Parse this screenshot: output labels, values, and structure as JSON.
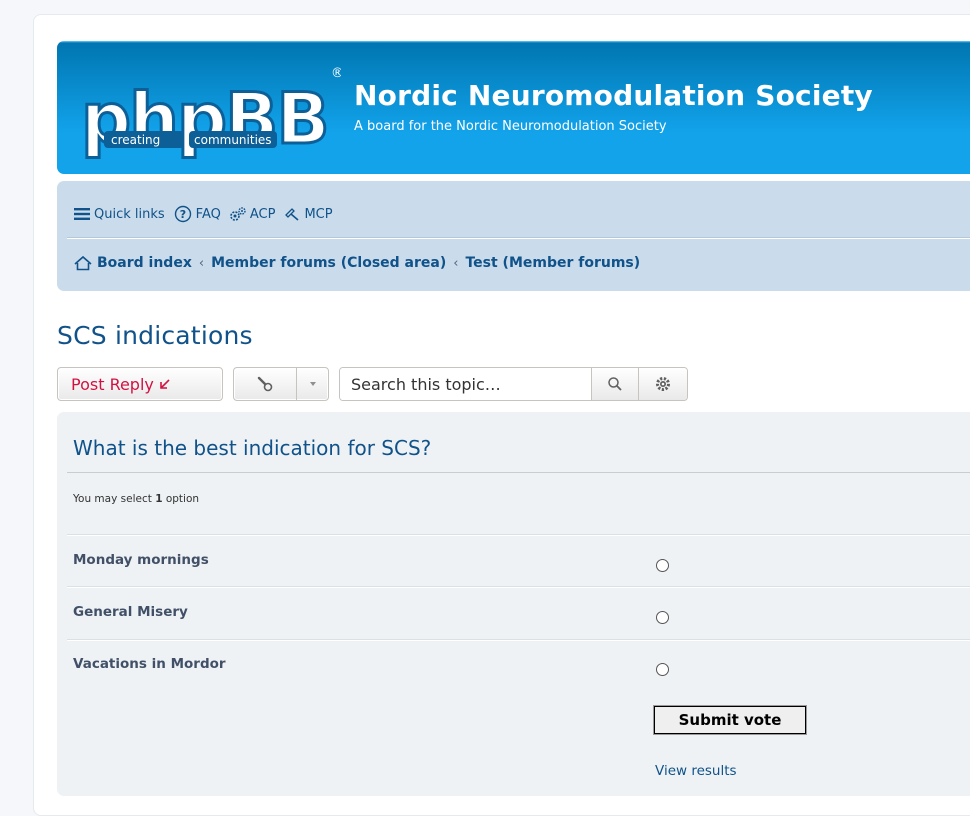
{
  "header": {
    "logo": {
      "word": "phpBB",
      "tagline_left": "creating",
      "tagline_right": "communities",
      "mark": "®"
    },
    "site_title": "Nordic Neuromodulation Society",
    "site_description": "A board for the Nordic Neuromodulation Society"
  },
  "navbar": {
    "quick_links": [
      {
        "label": "Quick links",
        "icon": "hamburger-icon"
      },
      {
        "label": "FAQ",
        "icon": "question-circle-icon"
      },
      {
        "label": "ACP",
        "icon": "cogs-icon"
      },
      {
        "label": "MCP",
        "icon": "gavel-icon"
      }
    ],
    "breadcrumbs": [
      "Board index",
      "Member forums (Closed area)",
      "Test (Member forums)"
    ],
    "breadcrumb_separator": "‹"
  },
  "topic": {
    "title": "SCS indications",
    "post_reply_label": "Post Reply",
    "search_placeholder": "Search this topic…"
  },
  "poll": {
    "question": "What is the best indication for SCS?",
    "hint_prefix": "You may select ",
    "hint_count": "1",
    "hint_suffix": " option",
    "options": [
      {
        "label": "Monday mornings",
        "selected": false
      },
      {
        "label": "General Misery",
        "selected": false
      },
      {
        "label": "Vacations in Mordor",
        "selected": false
      }
    ],
    "submit_label": "Submit vote",
    "view_results_label": "View results"
  },
  "colors": {
    "header_blue": "#12a3eb",
    "navbar_bg": "#cadceb",
    "panel_bg": "#eef2f5",
    "link_blue": "#105289",
    "reply_red": "#d31141"
  }
}
